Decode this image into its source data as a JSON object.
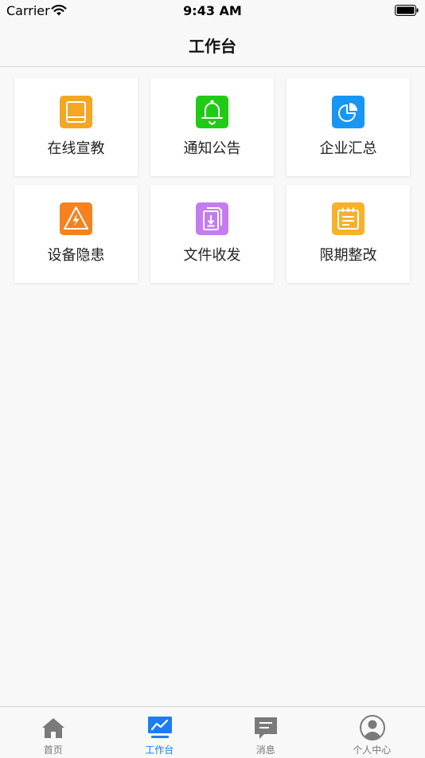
{
  "status_bar": {
    "carrier": "Carrier",
    "time": "9:43 AM"
  },
  "nav": {
    "title": "工作台"
  },
  "grid": {
    "items": [
      {
        "label": "在线宣教",
        "icon": "book-icon",
        "color": "#f5a623"
      },
      {
        "label": "通知公告",
        "icon": "bell-icon",
        "color": "#1fcb15"
      },
      {
        "label": "企业汇总",
        "icon": "pie-chart-icon",
        "color": "#1796f5"
      },
      {
        "label": "设备隐患",
        "icon": "warning-lightning-icon",
        "color": "#f5821f"
      },
      {
        "label": "文件收发",
        "icon": "file-download-icon",
        "color": "#c47cf0"
      },
      {
        "label": "限期整改",
        "icon": "notepad-icon",
        "color": "#f7b12a"
      }
    ]
  },
  "tab_bar": {
    "active_color": "#1a7df4",
    "inactive_color": "#777777",
    "tabs": [
      {
        "label": "首页",
        "icon": "home-icon"
      },
      {
        "label": "工作台",
        "icon": "trend-chart-icon",
        "active": true
      },
      {
        "label": "消息",
        "icon": "message-icon"
      },
      {
        "label": "个人中心",
        "icon": "user-circle-icon"
      }
    ]
  }
}
